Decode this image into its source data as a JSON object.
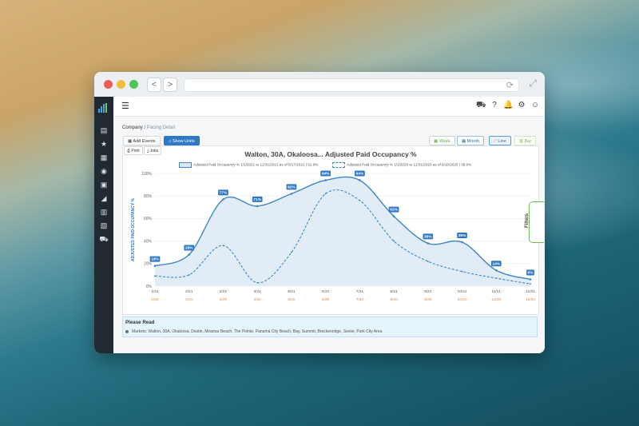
{
  "browser": {
    "buttons": {
      "back": "<",
      "forward": ">"
    },
    "icons": {
      "reload": "reload-icon",
      "expand": "expand-icon"
    },
    "colors": {
      "close": "#ee5e55",
      "minimize": "#f4bc3e",
      "maximize": "#52c25b"
    }
  },
  "sidebar": {
    "icons": [
      "dashboard-icon",
      "star-icon",
      "reports-icon",
      "eye-icon",
      "calendar-icon",
      "megaphone-icon",
      "image-icon",
      "table-icon",
      "cart-icon"
    ],
    "glyphs": [
      "▤",
      "★",
      "▦",
      "◉",
      "▣",
      "◢",
      "▥",
      "▧",
      "⛟"
    ]
  },
  "topbar": {
    "icons": [
      "cart-icon",
      "help-icon",
      "bell-icon",
      "gear-icon",
      "user-icon"
    ],
    "glyphs": [
      "⛟",
      "?",
      "🔔",
      "⚙",
      "☺"
    ]
  },
  "breadcrumb": {
    "parent": "Company",
    "separator": " / ",
    "current": "Pacing Detail"
  },
  "toolbar": {
    "add_events": "Add Events",
    "show_units": "Show Units",
    "week": "Week",
    "month": "Month",
    "line": "Line",
    "bar": "Bar",
    "print": "Print",
    "jobs": "Jobs"
  },
  "filters_label": "Filters",
  "please_read": {
    "title": "Please Read",
    "markets": "Markets: Walton, 30A, Okaloosa, Destin, Miramar Beach, The Pointe, Panama City Beach, Bay, Summit, Breckenridge, Sevier, Park City Area"
  },
  "chart_data": {
    "type": "line",
    "title": "Walton, 30A, Okaloosa... Adjusted Paid Occupancy %",
    "ylabel": "ADJUSTED PAID OCCUPANCY %",
    "ylim": [
      0,
      100
    ],
    "y_ticks": [
      "0%",
      "20%",
      "40%",
      "60%",
      "80%",
      "100%"
    ],
    "categories": [
      "1/21",
      "2/21",
      "3/21",
      "4/21",
      "5/21",
      "6/21",
      "7/21",
      "8/21",
      "9/21",
      "10/21",
      "11/21",
      "12/21"
    ],
    "categories_secondary": [
      "1/20",
      "2/20",
      "3/20",
      "4/20",
      "5/20",
      "6/20",
      "7/20",
      "8/20",
      "9/20",
      "10/20",
      "11/20",
      "12/20"
    ],
    "series": [
      {
        "name": "Adjusted Paid Occupancy % 1/1/2021 to 12/31/2021 as of 6/17/2021 | 52.8%",
        "style": "solid",
        "color": "#3d86c6",
        "values": [
          18,
          28,
          77,
          71,
          82,
          94,
          94,
          62,
          38,
          39,
          14,
          6
        ],
        "labels": [
          "18%",
          "28%",
          "77%",
          "71%",
          "82%",
          "94%",
          "94%",
          "62%",
          "38%",
          "39%",
          "14%",
          "6%"
        ]
      },
      {
        "name": "Adjusted Paid Occupancy % 1/1/2020 to 12/31/2020 as of 6/16/2020 | 39.6%",
        "style": "dashed",
        "color": "#3d86c6",
        "values": [
          9,
          10,
          36,
          3,
          30,
          82,
          76,
          40,
          22,
          13,
          7,
          2
        ]
      }
    ],
    "grid": true,
    "legend": "top-center",
    "colors": {
      "tick_primary": "#555555",
      "tick_secondary": "#e8884a",
      "area_fill": "#dce9f5"
    }
  }
}
